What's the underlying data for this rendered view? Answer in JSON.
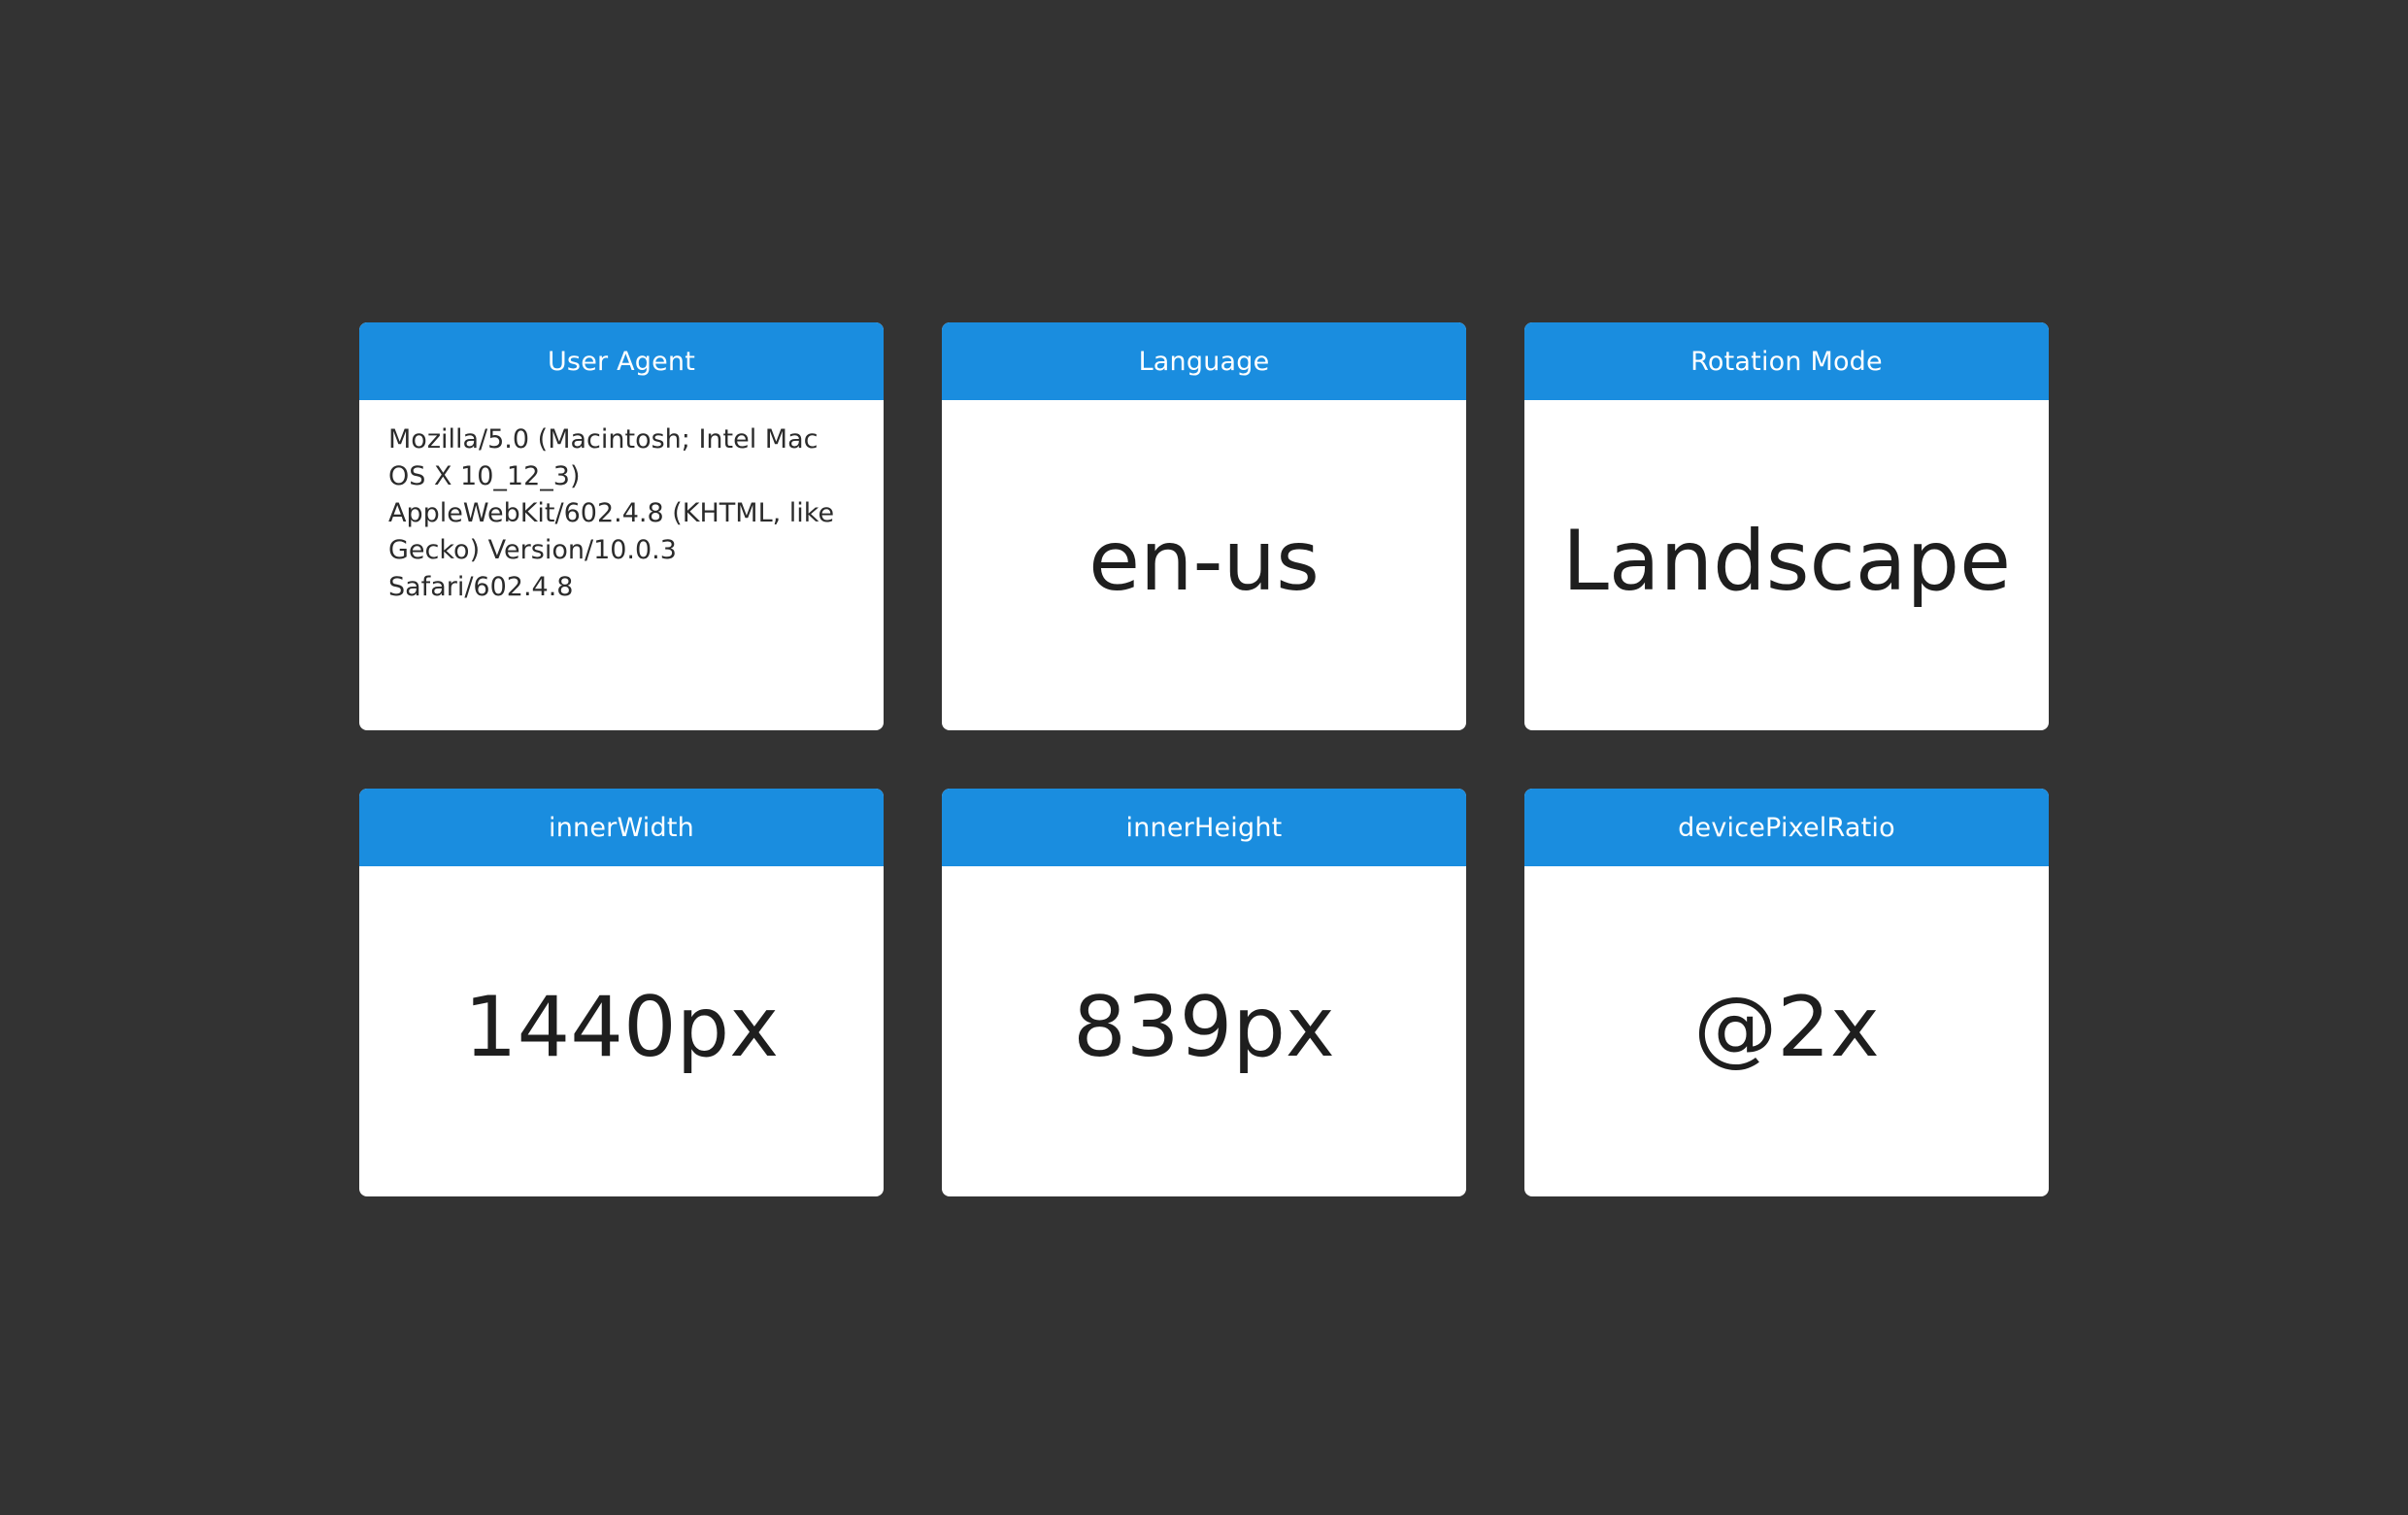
{
  "cards": [
    {
      "title": "User Agent",
      "value": "Mozilla/5.0 (Macintosh; Intel Mac OS X 10_12_3) AppleWebKit/602.4.8 (KHTML, like Gecko) Version/10.0.3 Safari/602.4.8"
    },
    {
      "title": "Language",
      "value": "en-us"
    },
    {
      "title": "Rotation Mode",
      "value": "Landscape"
    },
    {
      "title": "innerWidth",
      "value": "1440px"
    },
    {
      "title": "innerHeight",
      "value": "839px"
    },
    {
      "title": "devicePixelRatio",
      "value": "@2x"
    }
  ],
  "colors": {
    "background": "#333333",
    "header": "#1a8ddf",
    "card": "#ffffff"
  }
}
